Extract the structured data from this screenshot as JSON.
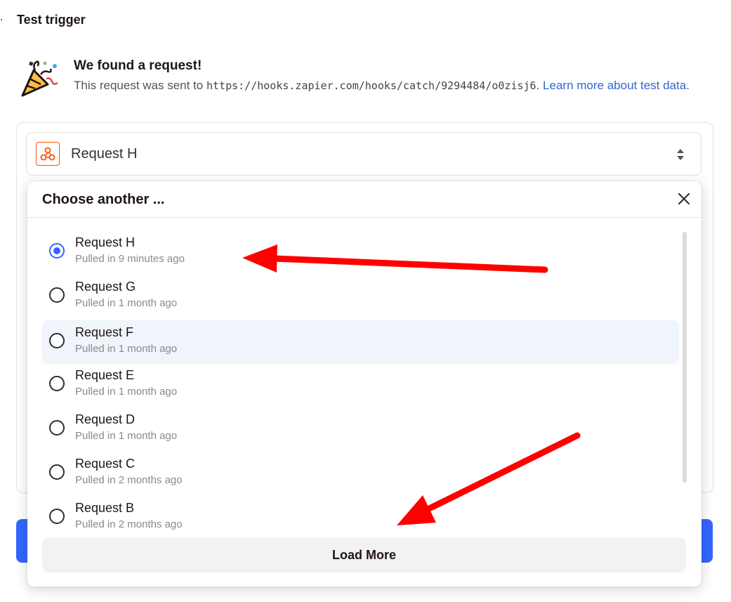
{
  "section": {
    "title": "Test trigger"
  },
  "found": {
    "title": "We found a request!",
    "desc_prefix": "This request was sent to ",
    "url": "https://hooks.zapier.com/hooks/catch/9294484/o0zisj6",
    "desc_sep": ". ",
    "link": "Learn more about test data",
    "desc_suffix": "."
  },
  "select": {
    "value": "Request H"
  },
  "dropdown": {
    "title": "Choose another ...",
    "options": [
      {
        "name": "Request H",
        "time": "Pulled in 9 minutes ago",
        "checked": true
      },
      {
        "name": "Request G",
        "time": "Pulled in 1 month ago",
        "checked": false
      },
      {
        "name": "Request F",
        "time": "Pulled in 1 month ago",
        "checked": false
      },
      {
        "name": "Request E",
        "time": "Pulled in 1 month ago",
        "checked": false
      },
      {
        "name": "Request D",
        "time": "Pulled in 1 month ago",
        "checked": false
      },
      {
        "name": "Request C",
        "time": "Pulled in 2 months ago",
        "checked": false
      },
      {
        "name": "Request B",
        "time": "Pulled in 2 months ago",
        "checked": false
      }
    ],
    "load_more": "Load More"
  },
  "colors": {
    "accent": "#3366ff",
    "annotation": "#ff0000",
    "brand": "#ff4f00"
  },
  "icons": {
    "party": "party-popper-icon",
    "webhook": "webhook-icon",
    "sort": "sort-icon",
    "close": "close-icon"
  }
}
